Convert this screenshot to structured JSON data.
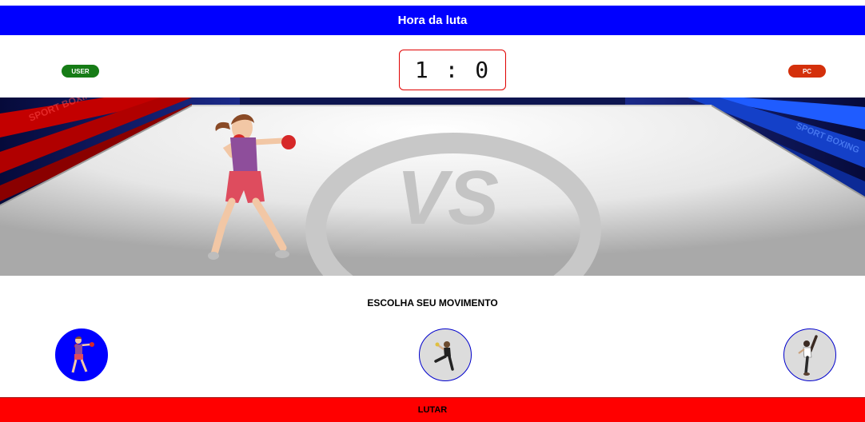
{
  "header": {
    "title": "Hora da luta"
  },
  "players": {
    "user_label": "USER",
    "pc_label": "PC"
  },
  "score": {
    "user": 1,
    "pc": 0,
    "display": "1 : 0"
  },
  "arena": {
    "center_text": "VS",
    "banner_text_left": "SPORT BOXING",
    "banner_text_right": "SPORT BOXING"
  },
  "moves": {
    "prompt": "ESCOLHA SEU MOVIMENTO",
    "items": [
      {
        "name": "punch",
        "icon": "punch-boxer-icon",
        "selected": true
      },
      {
        "name": "kick",
        "icon": "kick-fighter-icon",
        "selected": false
      },
      {
        "name": "high-kick",
        "icon": "high-kick-fighter-icon",
        "selected": false
      }
    ]
  },
  "actions": {
    "fight_label": "LUTAR"
  },
  "colors": {
    "header": "#0000ff",
    "user_badge": "#167c16",
    "pc_badge": "#d4300b",
    "fight_button": "#ff0000",
    "selected_move": "#0000ff"
  }
}
